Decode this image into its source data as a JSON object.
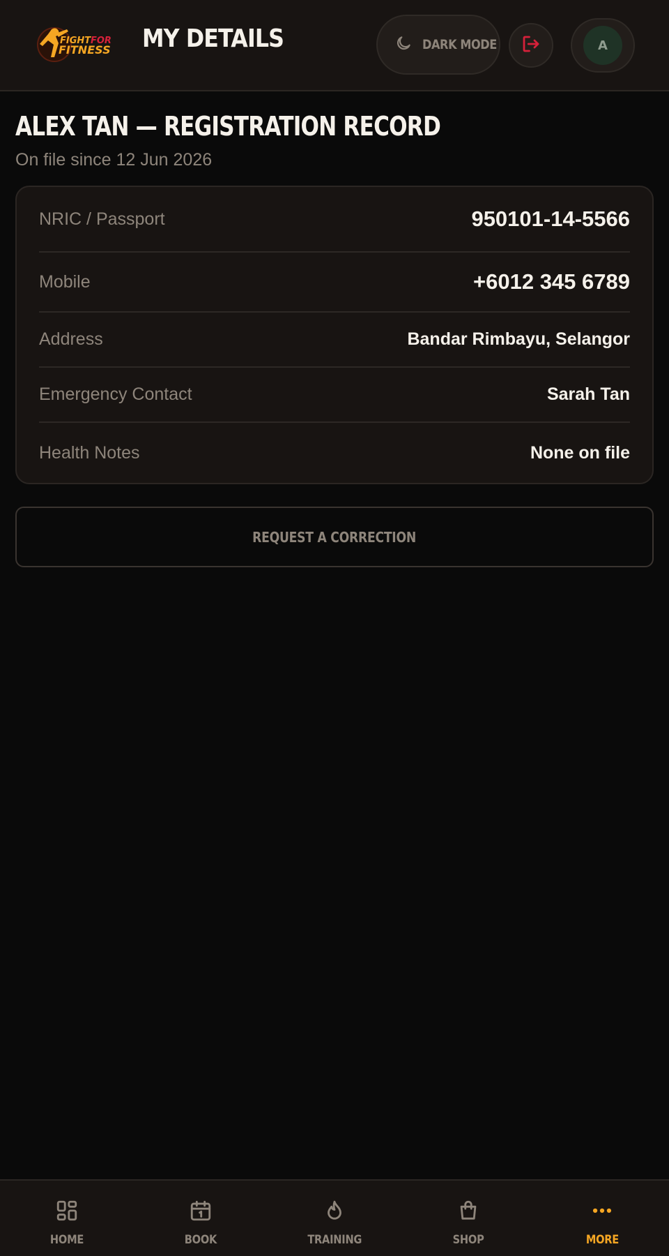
{
  "header": {
    "logo_text_top": "FIGHT FOR",
    "logo_text_bottom": "FITNESS",
    "title": "MY DETAILS",
    "dark_mode_label": "DARK MODE",
    "avatar_initial": "A"
  },
  "record": {
    "title": "ALEX TAN — REGISTRATION RECORD",
    "subtitle": "On file since 12 Jun 2026",
    "fields": [
      {
        "label": "NRIC / Passport",
        "value": "950101-14-5566"
      },
      {
        "label": "Mobile",
        "value": "+6012 345 6789"
      },
      {
        "label": "Address",
        "value": "Bandar Rimbayu, Selangor"
      },
      {
        "label": "Emergency Contact",
        "value": "Sarah Tan"
      },
      {
        "label": "Health Notes",
        "value": "None on file"
      }
    ],
    "correction_label": "REQUEST A CORRECTION"
  },
  "nav": {
    "items": [
      {
        "label": "HOME",
        "icon": "grid-icon"
      },
      {
        "label": "BOOK",
        "icon": "calendar-icon"
      },
      {
        "label": "TRAINING",
        "icon": "flame-icon"
      },
      {
        "label": "SHOP",
        "icon": "bag-icon"
      },
      {
        "label": "MORE",
        "icon": "more-icon"
      }
    ],
    "active": "MORE"
  },
  "colors": {
    "accent": "#f5a623",
    "logout": "#d6213a",
    "background": "#0a0a0a",
    "surface": "#181412"
  }
}
